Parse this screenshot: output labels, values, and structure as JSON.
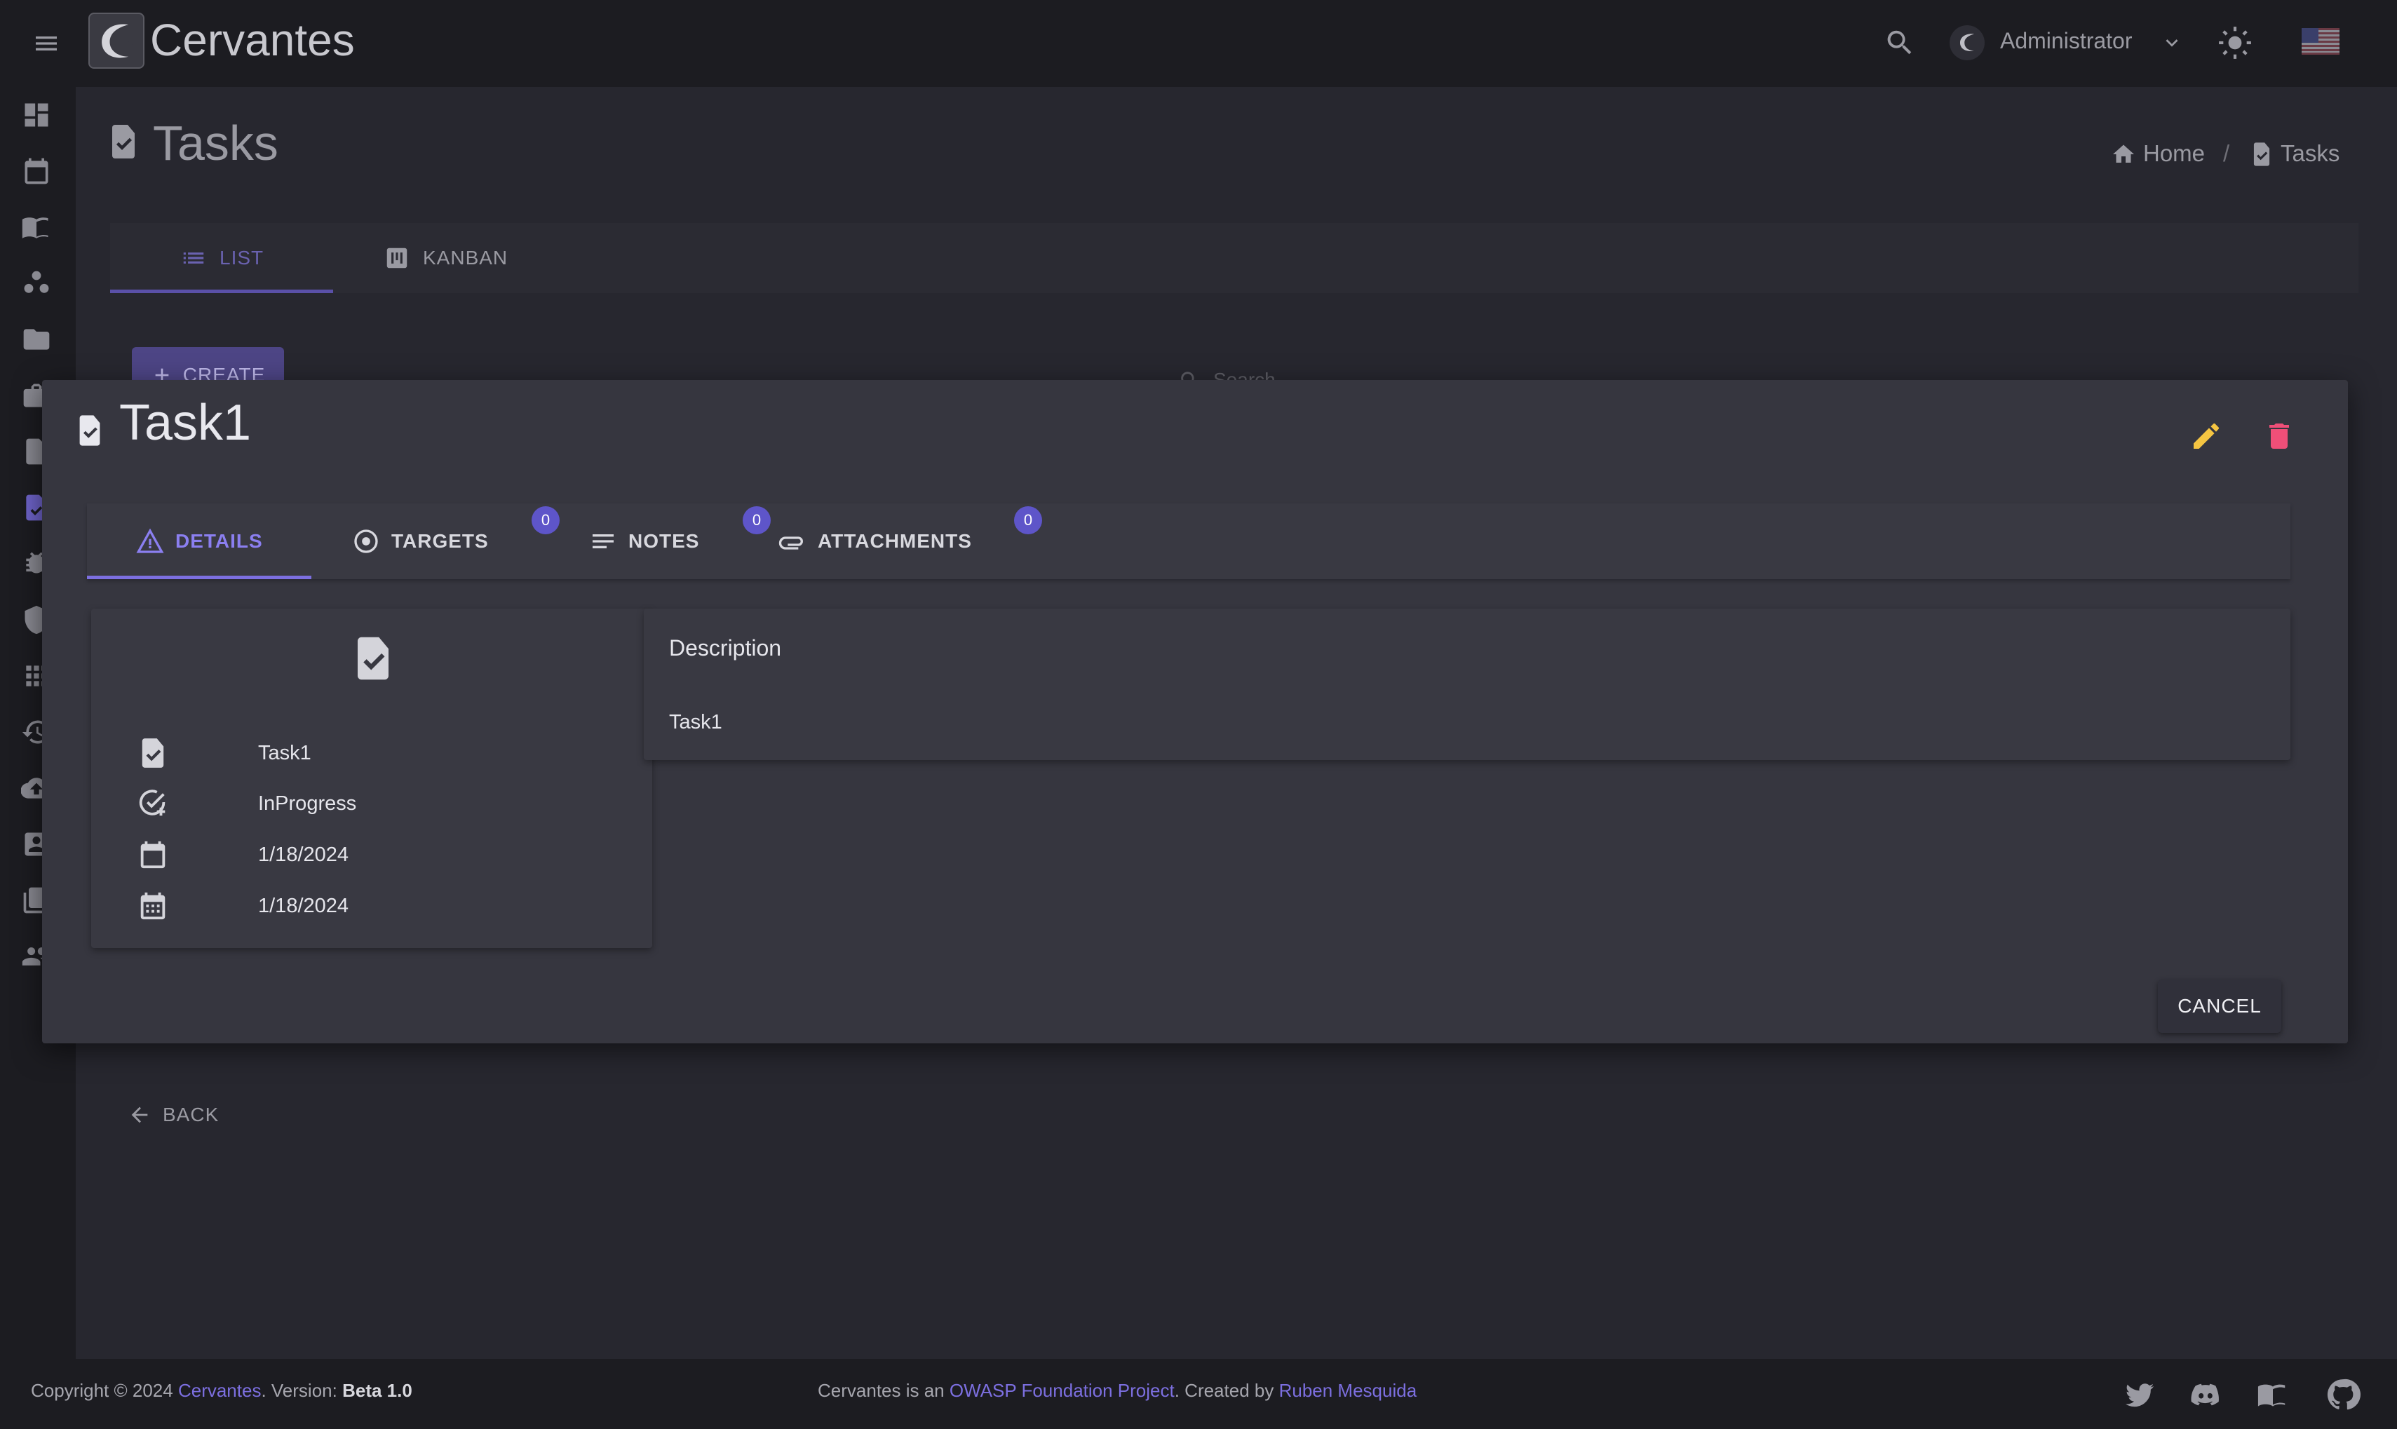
{
  "app": {
    "name": "Cervantes"
  },
  "topbar": {
    "user_name": "Administrator"
  },
  "page": {
    "title": "Tasks"
  },
  "breadcrumb": {
    "home": "Home",
    "separator": "/",
    "current": "Tasks"
  },
  "view_tabs": {
    "list": "LIST",
    "kanban": "KANBAN"
  },
  "actions": {
    "create": "CREATE",
    "back": "BACK",
    "search_placeholder": "Search"
  },
  "modal": {
    "title": "Task1",
    "tabs": {
      "details": "DETAILS",
      "targets": "TARGETS",
      "targets_count": "0",
      "notes": "NOTES",
      "notes_count": "0",
      "attachments": "ATTACHMENTS",
      "attachments_count": "0"
    },
    "info": {
      "name": "Task1",
      "status": "InProgress",
      "start_date": "1/18/2024",
      "end_date": "1/18/2024"
    },
    "description": {
      "heading": "Description",
      "text": "Task1"
    },
    "cancel": "CANCEL"
  },
  "footer": {
    "copyright": "Copyright © 2024",
    "brand_link": "Cervantes",
    "version_label": ". Version:",
    "version": "Beta 1.0",
    "project_prefix": "Cervantes is an",
    "owasp_link": "OWASP Foundation Project",
    "created_by": ". Created by",
    "author_link": "Ruben Mesquida"
  },
  "colors": {
    "accent": "#7c6fe0",
    "edit": "#f5c542",
    "delete": "#ef4f78",
    "background": "#27272f",
    "modal": "#36363f"
  },
  "icons": [
    "menu-icon",
    "search-icon",
    "chevron-down-icon",
    "sun-icon",
    "us-flag-icon",
    "task-icon",
    "home-icon",
    "list-icon",
    "kanban-icon",
    "plus-icon",
    "pencil-icon",
    "trash-icon",
    "warning-icon",
    "target-icon",
    "notes-icon",
    "paperclip-icon",
    "calendar-icon",
    "calendar-grid-icon",
    "status-check-icon",
    "arrow-left-icon",
    "twitter-icon",
    "discord-icon",
    "book-icon",
    "github-icon"
  ]
}
